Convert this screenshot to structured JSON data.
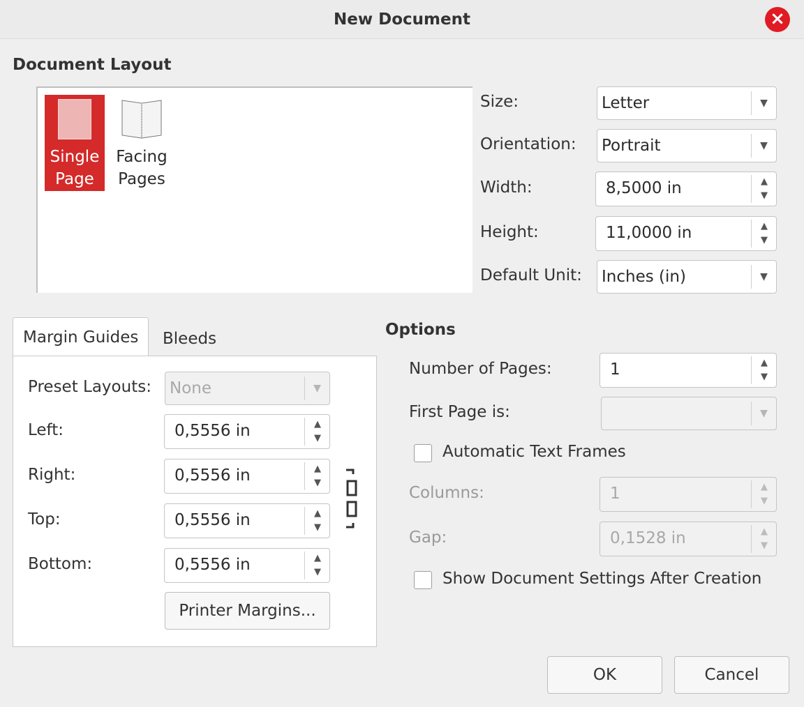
{
  "window": {
    "title": "New Document"
  },
  "document_layout": {
    "heading": "Document Layout",
    "options": [
      {
        "label_line1": "Single",
        "label_line2": "Page",
        "selected": true
      },
      {
        "label_line1": "Facing",
        "label_line2": "Pages",
        "selected": false
      }
    ]
  },
  "page": {
    "size_label": "Size:",
    "size_value": "Letter",
    "orientation_label": "Orientation:",
    "orientation_value": "Portrait",
    "width_label": "Width:",
    "width_value": "8,5000 in",
    "height_label": "Height:",
    "height_value": "11,0000 in",
    "default_unit_label": "Default Unit:",
    "default_unit_value": "Inches (in)"
  },
  "tabs": [
    {
      "label": "Margin Guides",
      "active": true
    },
    {
      "label": "Bleeds",
      "active": false
    }
  ],
  "margins": {
    "preset_label": "Preset Layouts:",
    "preset_value": "None",
    "left_label": "Left:",
    "left_value": "0,5556 in",
    "right_label": "Right:",
    "right_value": "0,5556 in",
    "top_label": "Top:",
    "top_value": "0,5556 in",
    "bottom_label": "Bottom:",
    "bottom_value": "0,5556 in",
    "printer_margins_button": "Printer Margins..."
  },
  "options": {
    "heading": "Options",
    "num_pages_label": "Number of Pages:",
    "num_pages_value": "1",
    "first_page_label": "First Page is:",
    "first_page_value": "",
    "auto_text_frames_label": "Automatic Text Frames",
    "auto_text_frames_checked": false,
    "columns_label": "Columns:",
    "columns_value": "1",
    "gap_label": "Gap:",
    "gap_value": "0,1528 in",
    "show_settings_label": "Show Document Settings After Creation",
    "show_settings_checked": false
  },
  "buttons": {
    "ok": "OK",
    "cancel": "Cancel"
  },
  "colors": {
    "accent": "#d42a2a",
    "close": "#e01b24"
  },
  "icons": {
    "close": "close-icon",
    "single_page": "single-page-icon",
    "facing_pages": "facing-pages-icon",
    "link": "chain-link-icon",
    "dropdown": "chevron-down-icon",
    "spin_up": "chevron-up-icon",
    "spin_down": "chevron-down-icon"
  }
}
